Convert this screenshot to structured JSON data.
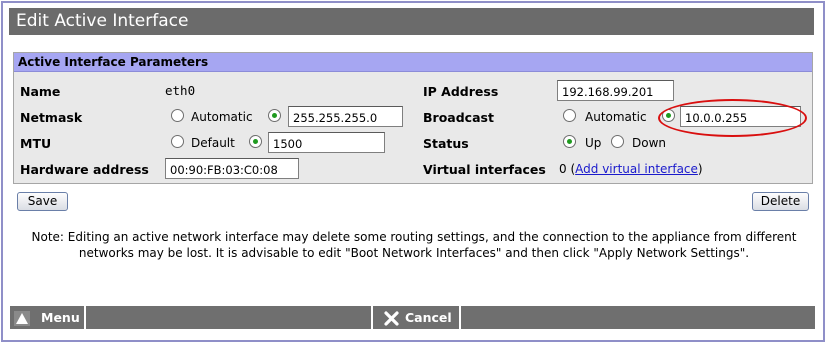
{
  "title": "Edit Active Interface",
  "panel_title": "Active Interface Parameters",
  "name": {
    "label": "Name",
    "value": "eth0"
  },
  "ip": {
    "label": "IP Address",
    "value": "192.168.99.201"
  },
  "netmask": {
    "label": "Netmask",
    "auto_label": "Automatic",
    "value": "255.255.255.0",
    "selected": "manual"
  },
  "broadcast": {
    "label": "Broadcast",
    "auto_label": "Automatic",
    "value": "10.0.0.255",
    "selected": "manual"
  },
  "mtu": {
    "label": "MTU",
    "default_label": "Default",
    "value": "1500",
    "selected": "manual"
  },
  "status": {
    "label": "Status",
    "up_label": "Up",
    "down_label": "Down",
    "selected": "up"
  },
  "hw": {
    "label": "Hardware address",
    "value": "00:90:FB:03:C0:08"
  },
  "virtual": {
    "label": "Virtual interfaces",
    "count": "0",
    "open": "(",
    "link": "Add virtual interface",
    "close": ")"
  },
  "buttons": {
    "save": "Save",
    "delete": "Delete"
  },
  "note": "Note: Editing an active network interface may delete some routing settings, and the connection to the appliance from different networks may be lost. It is advisable to edit \"Boot Network Interfaces\" and then click \"Apply Network Settings\".",
  "footer": {
    "menu": "Menu",
    "cancel": "Cancel"
  },
  "colors": {
    "titlebar": "#6b6b6b",
    "panel_header": "#a6a6f2",
    "annotation_circle": "#d90f0f",
    "radio_selected": "#1f9a1f"
  },
  "icons": {
    "menu": "triangle-up-icon",
    "cancel": "x-icon"
  }
}
